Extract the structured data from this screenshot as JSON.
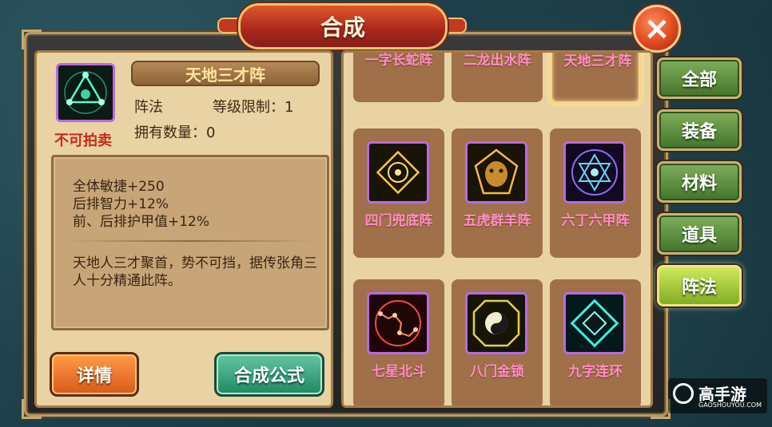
{
  "window": {
    "title": "合成",
    "close_symbol": "×"
  },
  "item": {
    "name": "天地三才阵",
    "tradable_status": "不可拍卖",
    "type": "阵法",
    "level_limit": "等级限制：1",
    "owned_count": "拥有数量：0",
    "stats": [
      "全体敏捷+250",
      "后排智力+12%",
      "前、后排护甲值+12%"
    ],
    "lore": "天地人三才聚首，势不可挡，据传张角三人十分精通此阵。",
    "icon": "triangle-formation-icon"
  },
  "buttons": {
    "detail": "详情",
    "formula": "合成公式"
  },
  "grid_items": [
    {
      "label": "一字长蛇阵",
      "icon": "snake-formation-icon",
      "selected": false
    },
    {
      "label": "二龙出水阵",
      "icon": "dragon-formation-icon",
      "selected": false
    },
    {
      "label": "天地三才阵",
      "icon": "triangle-formation-icon",
      "selected": true
    },
    {
      "label": "四门兜底阵",
      "icon": "four-gates-formation-icon",
      "selected": false
    },
    {
      "label": "五虎群羊阵",
      "icon": "tiger-formation-icon",
      "selected": false
    },
    {
      "label": "六丁六甲阵",
      "icon": "hexagram-formation-icon",
      "selected": false
    },
    {
      "label": "七星北斗",
      "icon": "seven-stars-formation-icon",
      "selected": false
    },
    {
      "label": "八门金锁",
      "icon": "bagua-formation-icon",
      "selected": false
    },
    {
      "label": "九字连环",
      "icon": "nine-chain-formation-icon",
      "selected": false
    }
  ],
  "tabs": [
    {
      "label": "全部",
      "active": false
    },
    {
      "label": "装备",
      "active": false
    },
    {
      "label": "材料",
      "active": false
    },
    {
      "label": "道具",
      "active": false
    },
    {
      "label": "阵法",
      "active": true
    }
  ],
  "watermark": {
    "text": "高手游",
    "sub": "GAOSHOUYOU.COM"
  },
  "colors": {
    "panel": "#e9d2a3",
    "title_banner": "#c23a1e",
    "item_label": "#ff8ec6",
    "tab_green": "#44742c",
    "tab_active": "#cfe85a",
    "warning_red": "#c92a1c"
  }
}
